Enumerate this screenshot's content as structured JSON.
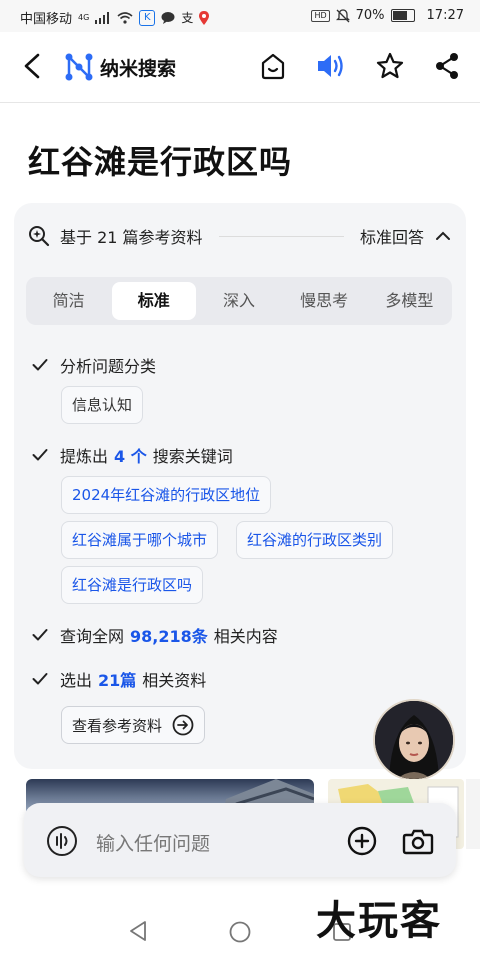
{
  "status": {
    "carrier": "中国移动",
    "signal": "4G",
    "battery": "70%",
    "time": "17:27"
  },
  "nav": {
    "app_name": "纳米搜索"
  },
  "page": {
    "title": "红谷滩是行政区吗"
  },
  "card": {
    "refs_text": "基于 21 篇参考资料",
    "mode_text": "标准回答",
    "tabs": [
      "简洁",
      "标准",
      "深入",
      "慢思考",
      "多模型"
    ],
    "active_tab": "标准",
    "step1": "分析问题分类",
    "chip1": "信息认知",
    "step2_pre": "提炼出",
    "step2_hl": "4 个",
    "step2_post": "搜索关键词",
    "keywords": [
      "2024年红谷滩的行政区地位",
      "红谷滩属于哪个城市",
      "红谷滩的行政区类别",
      "红谷滩是行政区吗"
    ],
    "step3_pre": "查询全网",
    "step3_hl": "98,218条",
    "step3_post": "相关内容",
    "step4_pre": "选出",
    "step4_hl": "21篇",
    "step4_post": "相关资料",
    "ref_button": "查看参考资料"
  },
  "input": {
    "placeholder": "输入任何问题"
  },
  "watermark": "大玩客",
  "colors": {
    "accent": "#1a56e8",
    "card_bg": "#f4f5f7"
  }
}
